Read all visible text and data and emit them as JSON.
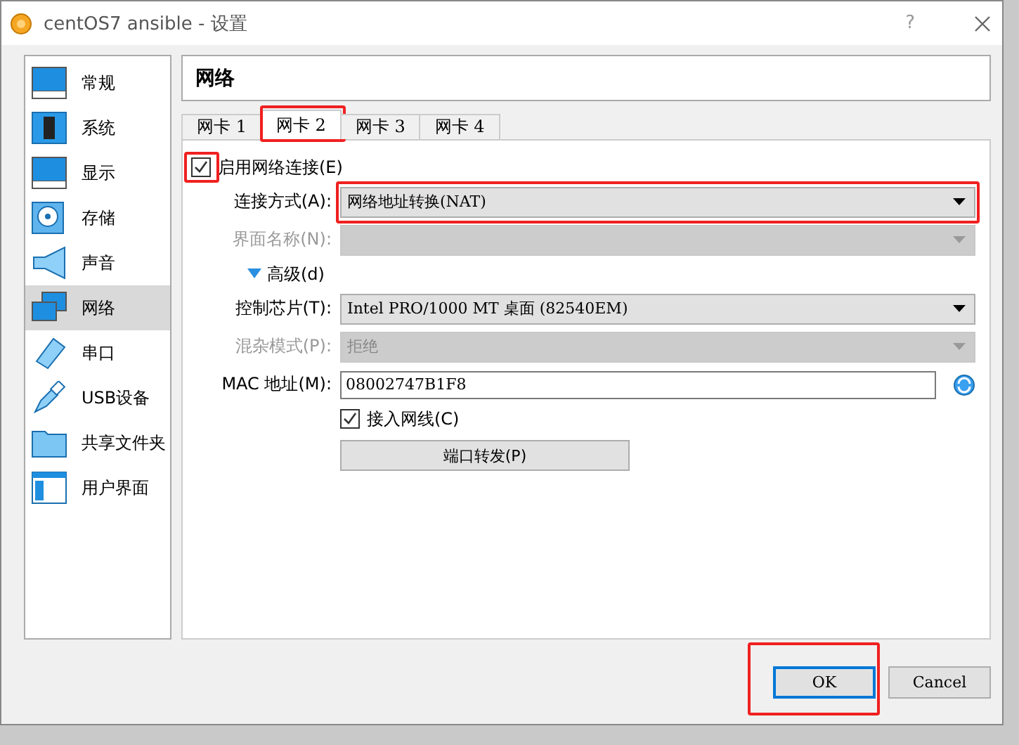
{
  "window": {
    "title": "centOS7 ansible - 设置",
    "help": "?"
  },
  "sidebar": {
    "items": [
      {
        "label": "常规",
        "selected": false
      },
      {
        "label": "系统",
        "selected": false
      },
      {
        "label": "显示",
        "selected": false
      },
      {
        "label": "存储",
        "selected": false
      },
      {
        "label": "声音",
        "selected": false
      },
      {
        "label": "网络",
        "selected": true
      },
      {
        "label": "串口",
        "selected": false
      },
      {
        "label": "USB设备",
        "selected": false
      },
      {
        "label": "共享文件夹",
        "selected": false
      },
      {
        "label": "用户界面",
        "selected": false
      }
    ]
  },
  "page_title": "网络",
  "tabs": [
    {
      "label": "网卡 1",
      "selected": false
    },
    {
      "label": "网卡 2",
      "selected": true,
      "highlighted": true
    },
    {
      "label": "网卡 3",
      "selected": false
    },
    {
      "label": "网卡 4",
      "selected": false
    }
  ],
  "enable": {
    "label": "启用网络连接(E)",
    "checked": true,
    "highlighted": true
  },
  "fields_top": [
    {
      "kind": "select",
      "label": "连接方式(A):",
      "value": "网络地址转换(NAT)",
      "disabled": false,
      "highlighted": true
    },
    {
      "kind": "select",
      "label": "界面名称(N):",
      "disabled": true
    }
  ],
  "advanced": {
    "label": "高级(d)",
    "expanded": true
  },
  "fields_advanced": [
    {
      "kind": "select",
      "label": "控制芯片(T):",
      "value": "Intel PRO/1000 MT 桌面 (82540EM)",
      "disabled": false
    },
    {
      "kind": "select",
      "label": "混杂模式(P):",
      "value": "拒绝",
      "disabled": true
    },
    {
      "kind": "text",
      "label": "MAC 地址(M):",
      "value": "08002747B1F8",
      "disabled": false
    }
  ],
  "cable": {
    "label": "接入网线(C)",
    "checked": true
  },
  "port_forwarding": "端口转发(P)",
  "buttons": [
    {
      "label": "OK",
      "default": true,
      "highlighted": true
    },
    {
      "label": "Cancel",
      "default": false
    }
  ]
}
